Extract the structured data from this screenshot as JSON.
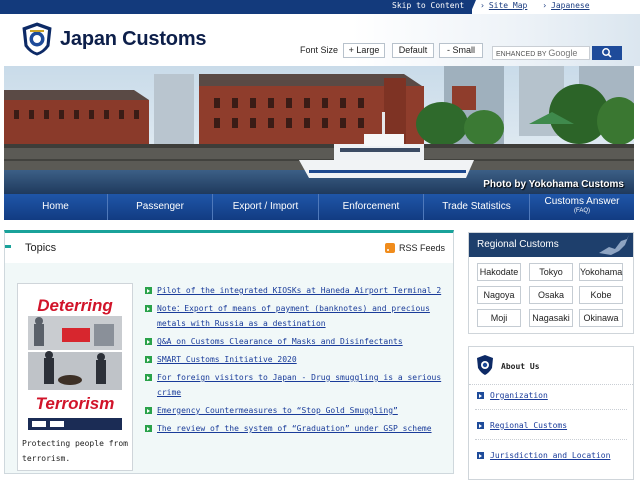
{
  "colors": {
    "brand_navy": "#133a7c",
    "nav_blue": "#1f56a8",
    "accent_teal": "#19a29a",
    "topic_bullet": "#2aa24a",
    "link": "#1a3c9a",
    "alert_red": "#d1142a"
  },
  "utility": {
    "skip_link": "Skip to Content",
    "site_map": "Site Map",
    "japanese": "Japanese"
  },
  "header": {
    "site_name": "Japan Customs",
    "font_size_label": "Font Size",
    "font_large": "+ Large",
    "font_default": "Default",
    "font_small": "- Small",
    "search_prefix": "ENHANCED BY",
    "search_brand": "Google"
  },
  "hero": {
    "credit": "Photo by Yokohama Customs"
  },
  "nav": {
    "items": [
      {
        "label": "Home"
      },
      {
        "label": "Passenger"
      },
      {
        "label": "Export / Import"
      },
      {
        "label": "Enforcement"
      },
      {
        "label": "Trade Statistics"
      },
      {
        "label": "Customs Answer",
        "sub": "(FAQ)"
      }
    ]
  },
  "topics": {
    "title": "Topics",
    "rss_label": "RSS Feeds",
    "promo": {
      "heading_top": "Deterring",
      "heading_bottom": "Terrorism",
      "caption": "Protecting people from terrorism."
    },
    "items": [
      "Pilot of the integrated KIOSKs at Haneda Airport Terminal 2",
      "Note：Export of means of payment (banknotes) and precious metals with Russia as a destination",
      "Q&A on Customs Clearance of Masks and Disinfectants",
      "SMART Customs Initiative 2020",
      "For foreign visitors to Japan - Drug smuggling is a serious crime",
      "Emergency Countermeasures to “Stop Gold Smuggling”",
      "The review of the system of “Graduation” under GSP scheme"
    ]
  },
  "regional": {
    "title": "Regional Customs",
    "cities": [
      "Hakodate",
      "Tokyo",
      "Yokohama",
      "Nagoya",
      "Osaka",
      "Kobe",
      "Moji",
      "Nagasaki",
      "Okinawa"
    ]
  },
  "about": {
    "title": "About Us",
    "links": [
      "Organization",
      "Regional Customs",
      "Jurisdiction and Location"
    ]
  }
}
